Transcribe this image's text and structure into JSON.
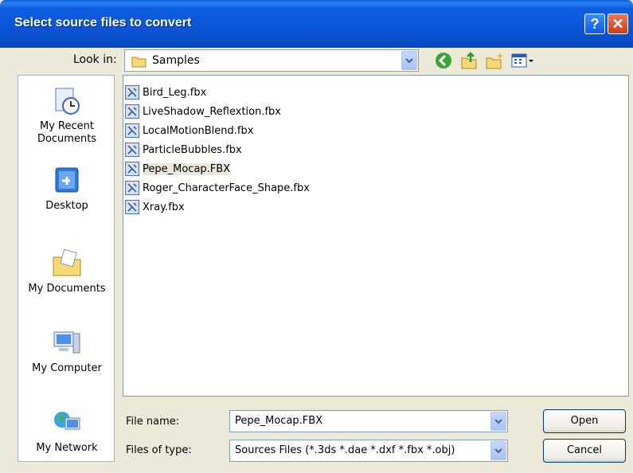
{
  "window": {
    "title": "Select source files to convert",
    "help_glyph": "?",
    "close_glyph": "✕"
  },
  "lookin": {
    "label": "Look in:",
    "value": "Samples",
    "icons": [
      "back-icon",
      "up-folder-icon",
      "new-folder-icon",
      "view-menu-icon"
    ]
  },
  "places": [
    {
      "label": "My Recent Documents",
      "icon": "recent-documents-icon"
    },
    {
      "label": "Desktop",
      "icon": "desktop-icon"
    },
    {
      "label": "My Documents",
      "icon": "my-documents-icon"
    },
    {
      "label": "My Computer",
      "icon": "my-computer-icon"
    },
    {
      "label": "My Network",
      "icon": "my-network-icon"
    }
  ],
  "files": [
    {
      "name": "Bird_Leg.fbx"
    },
    {
      "name": "LiveShadow_Reflextion.fbx"
    },
    {
      "name": "LocalMotionBlend.fbx"
    },
    {
      "name": "ParticleBubbles.fbx"
    },
    {
      "name": "Pepe_Mocap.FBX",
      "selected": true
    },
    {
      "name": "Roger_CharacterFace_Shape.fbx"
    },
    {
      "name": "Xray.fbx"
    }
  ],
  "filename": {
    "label": "File name:",
    "value": "Pepe_Mocap.FBX"
  },
  "filetype": {
    "label": "Files of type:",
    "value": "Sources Files (*.3ds *.dae *.dxf *.fbx *.obj)"
  },
  "buttons": {
    "open": "Open",
    "cancel": "Cancel"
  },
  "colors": {
    "titlebar": "#0a55d6",
    "dialog_bg": "#ece9d8",
    "selection": "#ebe8db"
  }
}
